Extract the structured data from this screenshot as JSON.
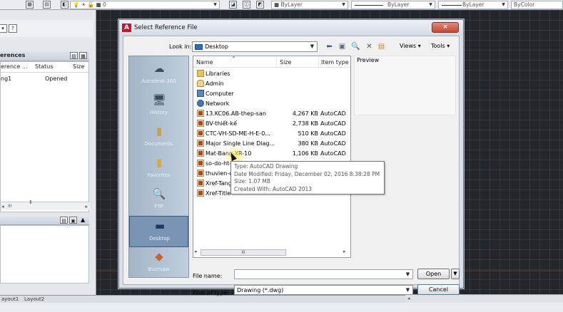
{
  "toolbar": {
    "layer_value": "0",
    "color": "ByLayer",
    "linetype": "ByLayer",
    "lineweight": "ByLayer",
    "plotstyle": "ByColor"
  },
  "xref_palette": {
    "header_title": "erences",
    "columns": [
      "erence ...",
      "Status",
      "Size"
    ],
    "rows": [
      {
        "name": "ng1",
        "status": "Opened",
        "size": ""
      }
    ],
    "scroll_thumb": "III",
    "bottom_tabs": [
      "ayout1",
      "Layout2"
    ]
  },
  "dialog": {
    "title": "Select Reference File",
    "close_glyph": "×",
    "look_in_label": "Look in:",
    "look_in_value": "Desktop",
    "views_label": "Views",
    "tools_label": "Tools",
    "places": [
      {
        "label": "Autodesk 360",
        "icon": "cloud-icon"
      },
      {
        "label": "History",
        "icon": "history-icon"
      },
      {
        "label": "Documents",
        "icon": "documents-icon"
      },
      {
        "label": "Favorites",
        "icon": "favorites-icon"
      },
      {
        "label": "FTP",
        "icon": "ftp-icon"
      },
      {
        "label": "Desktop",
        "icon": "desktop-icon"
      },
      {
        "label": "Buzzsaw",
        "icon": "buzzsaw-icon"
      }
    ],
    "columns": {
      "name": "Name",
      "size": "Size",
      "type": "Item type"
    },
    "files": [
      {
        "name": "Libraries",
        "size": "",
        "type": "",
        "icon": "folder"
      },
      {
        "name": "Admin",
        "size": "",
        "type": "",
        "icon": "user"
      },
      {
        "name": "Computer",
        "size": "",
        "type": "",
        "icon": "pc"
      },
      {
        "name": "Network",
        "size": "",
        "type": "",
        "icon": "net"
      },
      {
        "name": "13.KC06.AB-thep-san",
        "size": "4,267 KB",
        "type": "AutoCAD",
        "icon": "dwg"
      },
      {
        "name": "BV-thiết-kế",
        "size": "2,738 KB",
        "type": "AutoCAD",
        "icon": "dwg"
      },
      {
        "name": "CTC-VH-SD-ME-H-E-0...",
        "size": "510 KB",
        "type": "AutoCAD",
        "icon": "dwg"
      },
      {
        "name": "Major Single Line Diag...",
        "size": "380 KB",
        "type": "AutoCAD",
        "icon": "dwg"
      },
      {
        "name": "Mat-Bang-XR-10",
        "size": "1,106 KB",
        "type": "AutoCAD",
        "icon": "dwg"
      },
      {
        "name": "so-do-ht-",
        "size": "",
        "type": "",
        "icon": "dwg"
      },
      {
        "name": "thuvien-c",
        "size": "",
        "type": "",
        "icon": "dwg"
      },
      {
        "name": "Xref-Tang",
        "size": "",
        "type": "",
        "icon": "dwg"
      },
      {
        "name": "Xref-Title-",
        "size": "",
        "type": "",
        "icon": "dwg"
      }
    ],
    "scroll_thumb": "III",
    "preview_label": "Preview",
    "file_name_label": "File name:",
    "file_name_value": "",
    "files_of_type_label": "Files of type:",
    "files_of_type_value": "Drawing (*.dwg)",
    "open_label": "Open",
    "cancel_label": "Cancel",
    "tooltip": [
      "Type: AutoCAD Drawing",
      "Date Modified: Friday, December 02, 2016 8:38:28 PM",
      "Size: 1.07 MB",
      "Created With: AutoCAD 2013"
    ]
  },
  "colors": {
    "accent": "#2a6fc4",
    "close": "#c84530",
    "canvas": "#23272c"
  }
}
